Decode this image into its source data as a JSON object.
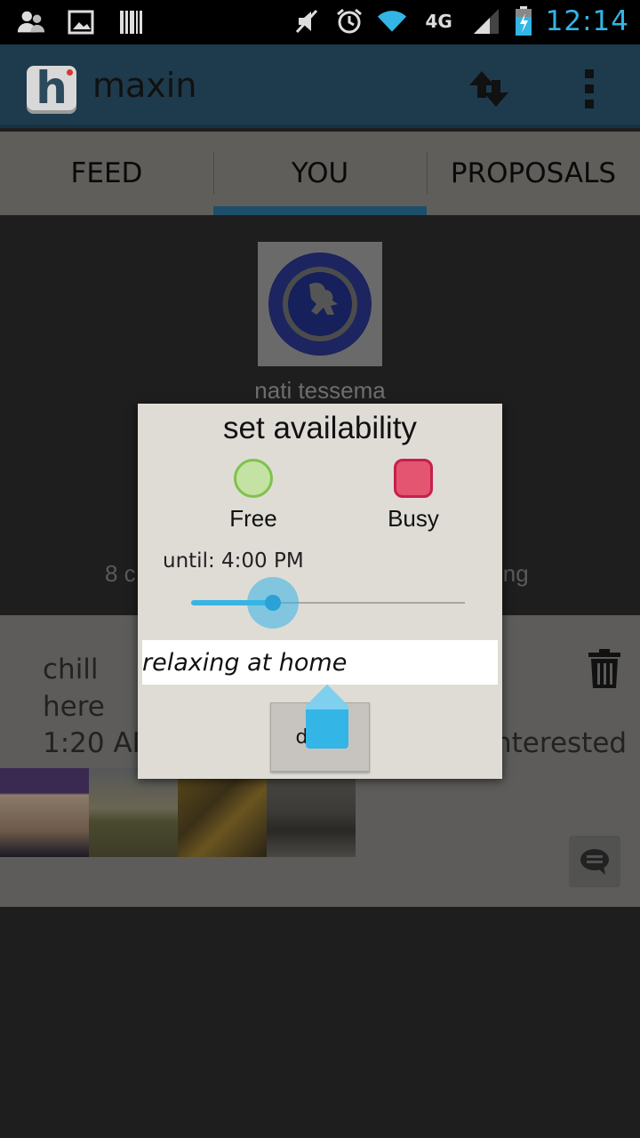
{
  "status_bar": {
    "time": "12:14",
    "left_icons": [
      "contacts-notification-icon",
      "image-notification-icon",
      "barcode-notification-icon"
    ],
    "right_icons": [
      "mute-icon",
      "alarm-icon",
      "wifi-icon",
      "4g-lte-icon",
      "signal-icon",
      "battery-icon"
    ],
    "network_label": "4G"
  },
  "action_bar": {
    "logo_letter": "h",
    "title": "maxin",
    "sync_icon": "sync-icon",
    "overflow_icon": "overflow-menu-icon"
  },
  "tabs": [
    {
      "label": "FEED",
      "active": false
    },
    {
      "label": "YOU",
      "active": true
    },
    {
      "label": "PROPOSALS",
      "active": false
    }
  ],
  "profile": {
    "name": "nati tessema",
    "stats_left": "8 c",
    "stats_right": "ing"
  },
  "post": {
    "title": "chill here",
    "time": "1:20 AM",
    "interested_label": "nterested",
    "photo_count": 4
  },
  "dialog": {
    "title": "set availability",
    "free_label": "Free",
    "busy_label": "Busy",
    "until_text": "until: 4:00 PM",
    "slider_fraction": 0.3,
    "status_value": "relaxing at home",
    "done_label": "done"
  },
  "colors": {
    "accent": "#33b5e5",
    "free": "#7ec24b",
    "busy": "#c71f4b"
  }
}
